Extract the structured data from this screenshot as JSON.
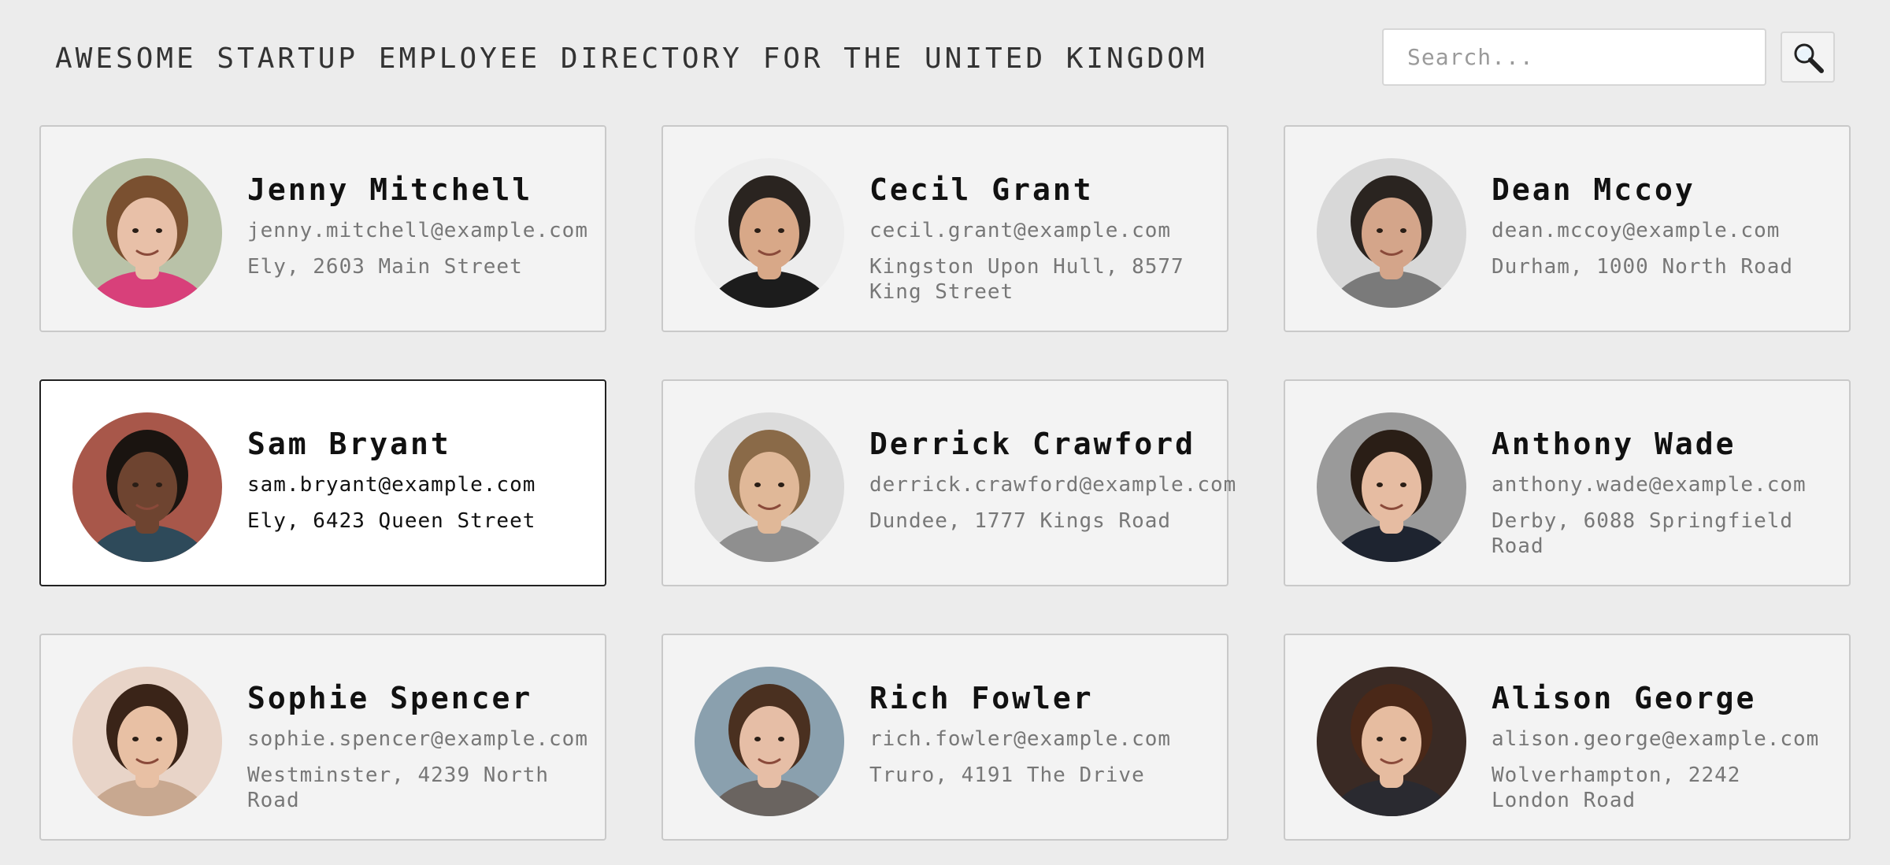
{
  "header": {
    "title": "AWESOME STARTUP EMPLOYEE DIRECTORY FOR THE UNITED KINGDOM",
    "search_placeholder": "Search...",
    "search_icon": "magnifier-icon"
  },
  "colors": {
    "background": "#ececec",
    "card_background": "#f3f3f3",
    "card_selected_background": "#ffffff",
    "card_border": "#c9c9c9",
    "card_selected_border": "#222222"
  },
  "employees": [
    {
      "name": "Jenny Mitchell",
      "email": "jenny.mitchell@example.com",
      "location": "Ely, 2603 Main Street",
      "selected": false,
      "avatar": {
        "bg": "#b9c2a8",
        "skin": "#e8c0a8",
        "hair": "#7a5030",
        "shirt": "#d8407a"
      }
    },
    {
      "name": "Cecil Grant",
      "email": "cecil.grant@example.com",
      "location": "Kingston Upon Hull, 8577 King Street",
      "selected": false,
      "avatar": {
        "bg": "#ededed",
        "skin": "#d8a888",
        "hair": "#2a2420",
        "shirt": "#1c1c1c"
      }
    },
    {
      "name": "Dean Mccoy",
      "email": "dean.mccoy@example.com",
      "location": "Durham, 1000 North Road",
      "selected": false,
      "avatar": {
        "bg": "#d8d8d8",
        "skin": "#d4a58a",
        "hair": "#2a2420",
        "shirt": "#7a7a7a"
      }
    },
    {
      "name": "Sam Bryant",
      "email": "sam.bryant@example.com",
      "location": "Ely, 6423 Queen Street",
      "selected": true,
      "avatar": {
        "bg": "#a8574a",
        "skin": "#6e4430",
        "hair": "#1a1410",
        "shirt": "#2e4a5a"
      }
    },
    {
      "name": "Derrick Crawford",
      "email": "derrick.crawford@example.com",
      "location": "Dundee, 1777 Kings Road",
      "selected": false,
      "avatar": {
        "bg": "#dcdcdc",
        "skin": "#e0b898",
        "hair": "#8a6a48",
        "shirt": "#8f8f8f"
      }
    },
    {
      "name": "Anthony Wade",
      "email": "anthony.wade@example.com",
      "location": "Derby, 6088 Springfield Road",
      "selected": false,
      "avatar": {
        "bg": "#9a9a9a",
        "skin": "#e6bca2",
        "hair": "#2a1e16",
        "shirt": "#1e2430"
      }
    },
    {
      "name": "Sophie Spencer",
      "email": "sophie.spencer@example.com",
      "location": "Westminster, 4239 North Road",
      "selected": false,
      "avatar": {
        "bg": "#e8d4c8",
        "skin": "#e8c0a4",
        "hair": "#3a2418",
        "shirt": "#c8a890"
      }
    },
    {
      "name": "Rich Fowler",
      "email": "rich.fowler@example.com",
      "location": "Truro, 4191 The Drive",
      "selected": false,
      "avatar": {
        "bg": "#8aa0ae",
        "skin": "#e6bea6",
        "hair": "#4a3020",
        "shirt": "#6a6460"
      }
    },
    {
      "name": "Alison George",
      "email": "alison.george@example.com",
      "location": "Wolverhampton, 2242 London Road",
      "selected": false,
      "avatar": {
        "bg": "#3a2a24",
        "skin": "#e6bca0",
        "hair": "#4a2818",
        "shirt": "#2a2a30"
      }
    }
  ]
}
